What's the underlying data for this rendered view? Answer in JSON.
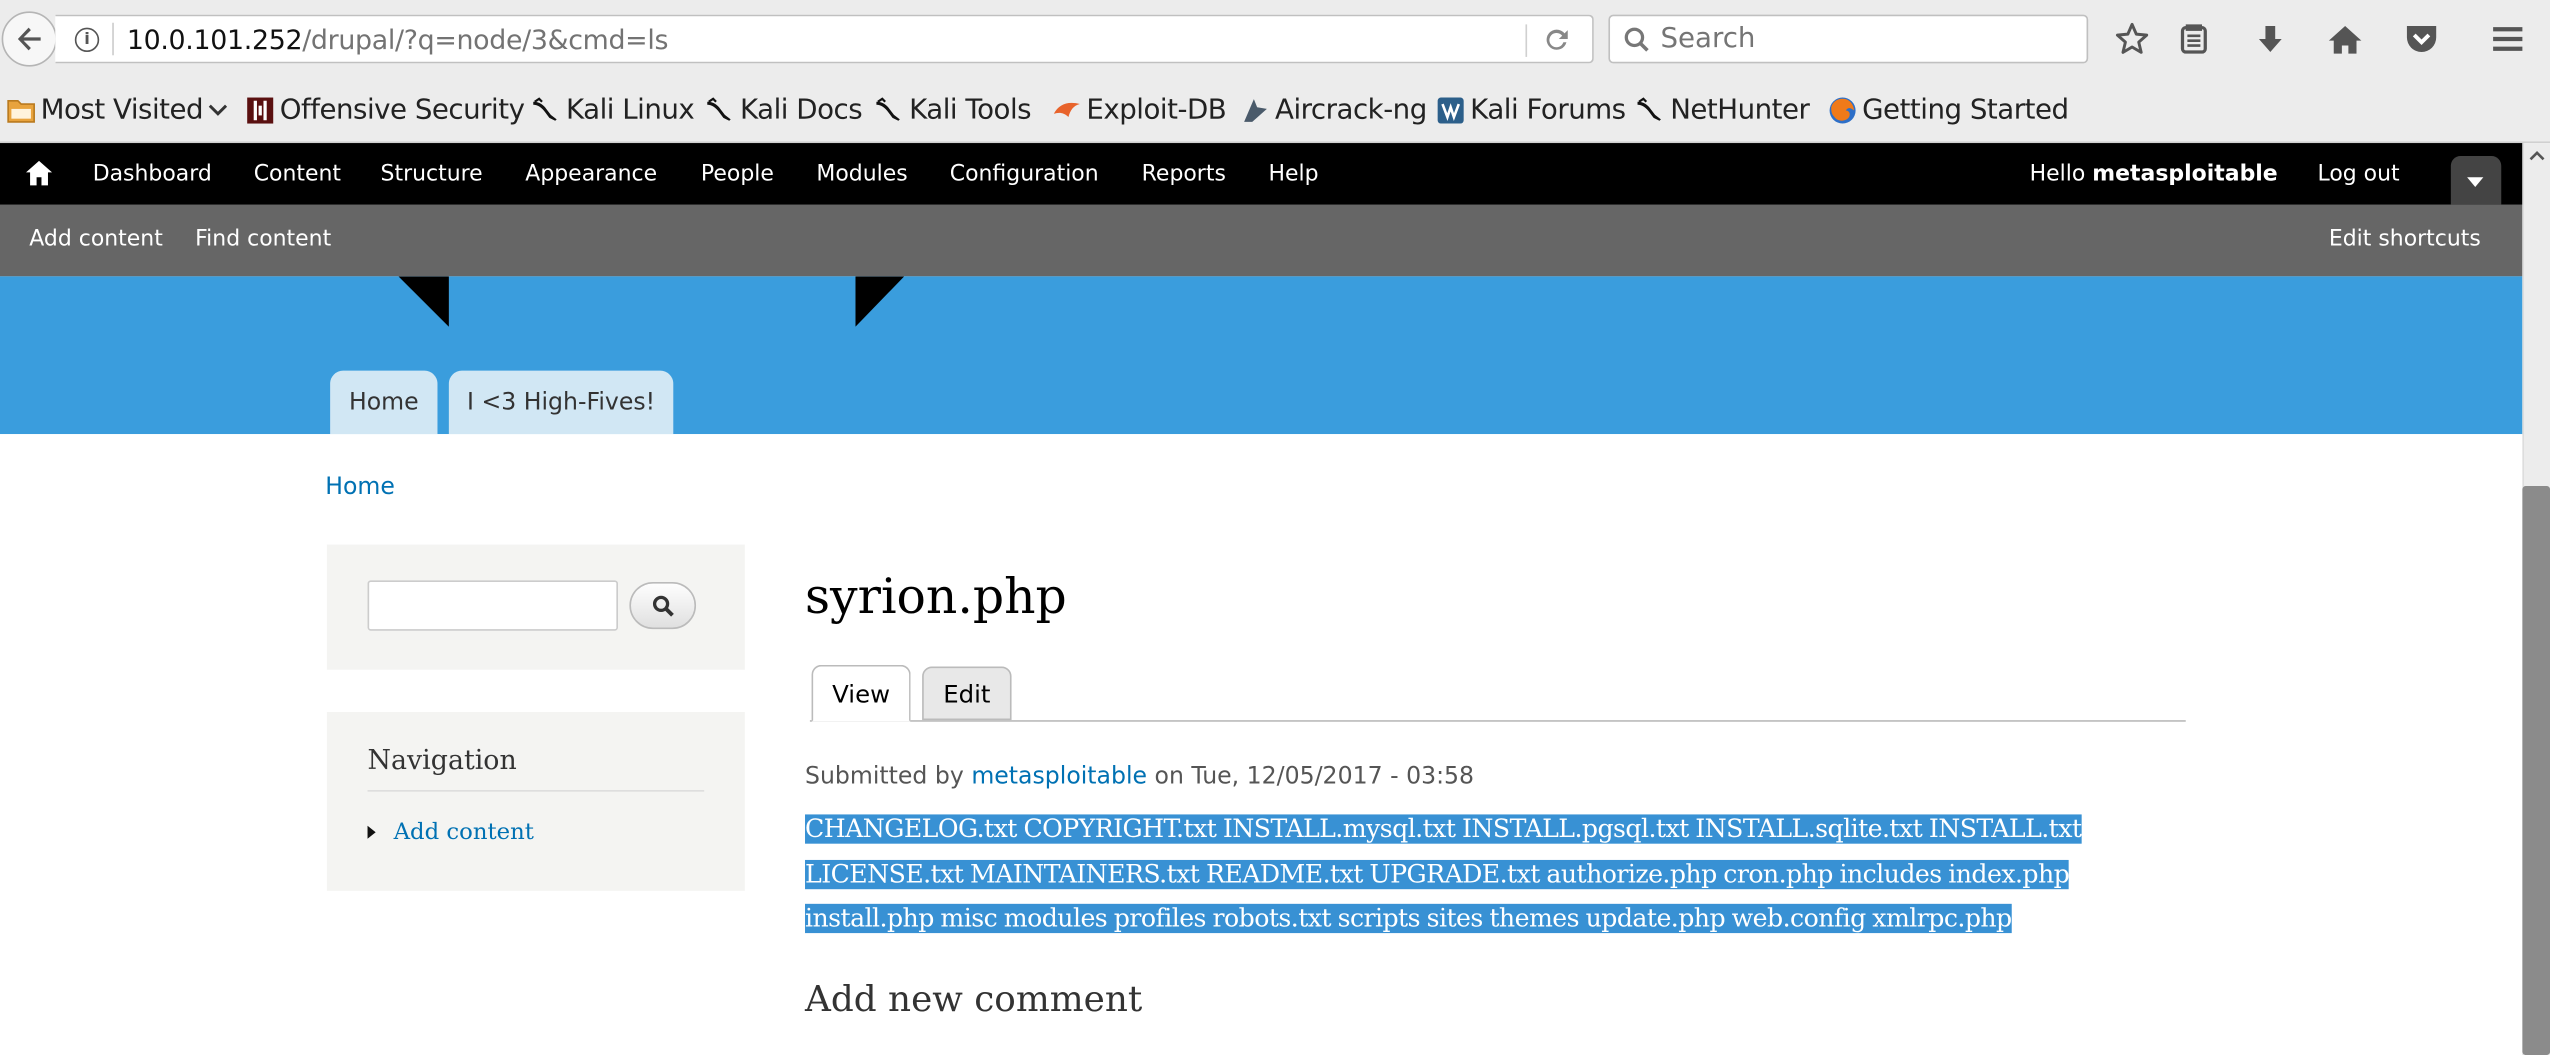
{
  "browser": {
    "url_host": "10.0.101.252",
    "url_path": "/drupal/?q=node/3&cmd=ls",
    "search_placeholder": "Search"
  },
  "bookmarks": [
    {
      "label": "Most Visited",
      "icon": "folder-icon",
      "dropdown": true
    },
    {
      "label": "Offensive Security",
      "icon": "offsec-icon"
    },
    {
      "label": "Kali Linux",
      "icon": "kali-dragon-icon"
    },
    {
      "label": "Kali Docs",
      "icon": "kali-dragon-icon"
    },
    {
      "label": "Kali Tools",
      "icon": "kali-dragon-icon"
    },
    {
      "label": "Exploit-DB",
      "icon": "exploit-db-icon"
    },
    {
      "label": "Aircrack-ng",
      "icon": "aircrack-icon"
    },
    {
      "label": "Kali Forums",
      "icon": "kali-forums-icon"
    },
    {
      "label": "NetHunter",
      "icon": "kali-dragon-icon"
    },
    {
      "label": "Getting Started",
      "icon": "firefox-icon"
    }
  ],
  "toolbar": {
    "menu": [
      "Dashboard",
      "Content",
      "Structure",
      "Appearance",
      "People",
      "Modules",
      "Configuration",
      "Reports",
      "Help"
    ],
    "hello_prefix": "Hello",
    "username": "metasploitable",
    "logout": "Log out"
  },
  "shortcuts": {
    "add_content": "Add content",
    "find_content": "Find content",
    "edit_shortcuts": "Edit shortcuts"
  },
  "header": {
    "tabs": [
      "Home",
      "I <3 High-Fives!"
    ]
  },
  "breadcrumb": "Home",
  "sidebar": {
    "navigation_title": "Navigation",
    "nav_items": [
      "Add content"
    ]
  },
  "node": {
    "title": "syrion.php",
    "tabs": [
      "View",
      "Edit"
    ],
    "submitted_prefix": "Submitted by",
    "author": "metasploitable",
    "submitted_date": "on Tue, 12/05/2017 - 03:58",
    "body_lines": [
      "CHANGELOG.txt COPYRIGHT.txt INSTALL.mysql.txt INSTALL.pgsql.txt INSTALL.sqlite.txt INSTALL.txt",
      "LICENSE.txt MAINTAINERS.txt README.txt UPGRADE.txt authorize.php cron.php includes index.php",
      "install.php misc modules profiles robots.txt scripts sites themes update.php web.config xmlrpc.php"
    ],
    "comment_heading": "Add new comment"
  },
  "colors": {
    "header_blue": "#3a9ddd",
    "link_blue": "#0071b3",
    "selection_blue": "#3891d4"
  }
}
